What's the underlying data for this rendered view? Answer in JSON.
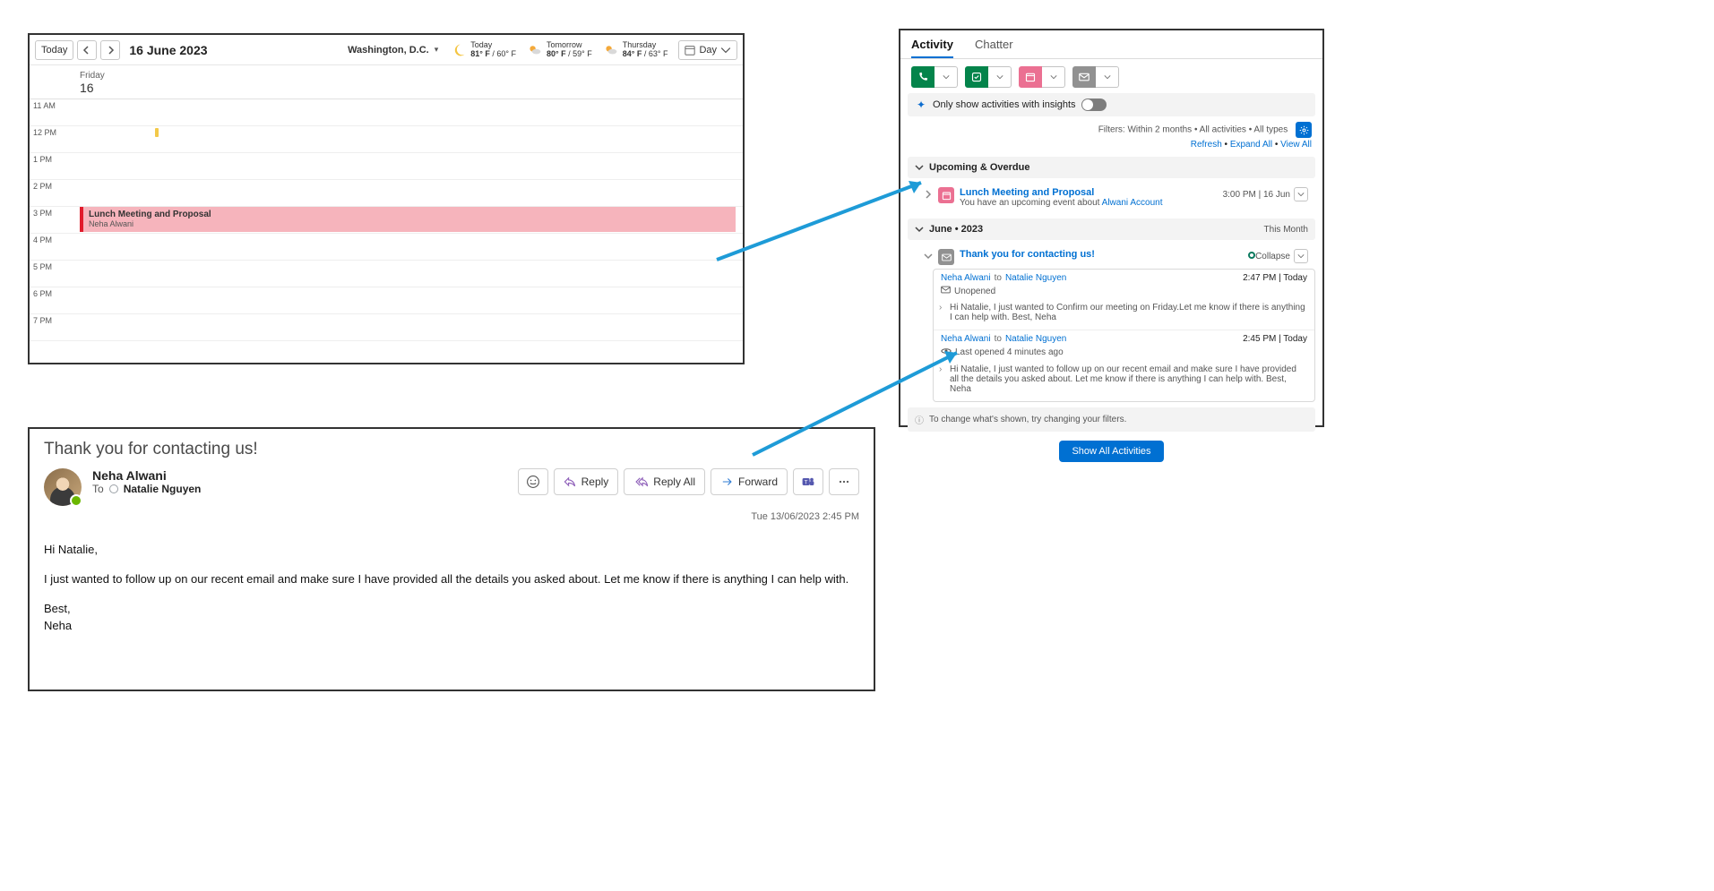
{
  "calendar": {
    "today_btn": "Today",
    "date_label": "16 June 2023",
    "location": "Washington, D.C.",
    "forecast": [
      {
        "label": "Today",
        "hi": "81° F",
        "lo": "60° F",
        "icon": "moon"
      },
      {
        "label": "Tomorrow",
        "hi": "80° F",
        "lo": "59° F",
        "icon": "sun-cloud"
      },
      {
        "label": "Thursday",
        "hi": "84° F",
        "lo": "63° F",
        "icon": "sun-cloud"
      }
    ],
    "view_label": "Day",
    "day_of_week": "Friday",
    "day_of_month": "16",
    "hours": [
      "11 AM",
      "12 PM",
      "1 PM",
      "2 PM",
      "3 PM",
      "4 PM",
      "5 PM",
      "6 PM",
      "7 PM"
    ],
    "busy_at_index": 1,
    "appointment": {
      "hour_index": 4,
      "title": "Lunch Meeting and Proposal",
      "who": "Neha Alwani"
    }
  },
  "activity": {
    "tabs": {
      "activity": "Activity",
      "chatter": "Chatter"
    },
    "insights_label": "Only show activities with insights",
    "filters_line": "Filters: Within 2 months • All activities • All types",
    "links": {
      "refresh": "Refresh",
      "expand": "Expand All",
      "view": "View All"
    },
    "section_upcoming": "Upcoming & Overdue",
    "upcoming_event": {
      "title": "Lunch Meeting and Proposal",
      "sub_prefix": "You have an upcoming event about ",
      "account": "Alwani Account",
      "when": "3:00 PM | 16 Jun"
    },
    "month_header": "June  •  2023",
    "month_rhs": "This Month",
    "email_thread": {
      "subject": "Thank you for contacting us!",
      "collapse": "Collapse",
      "msgs": [
        {
          "from": "Neha Alwani",
          "to": "Natalie Nguyen",
          "ts": "2:47 PM | Today",
          "status_icon": "envelope",
          "status": "Unopened",
          "snippet": "Hi Natalie, I just wanted to Confirm our meeting on Friday.Let me know if there is anything I can help with. Best, Neha"
        },
        {
          "from": "Neha Alwani",
          "to": "Natalie Nguyen",
          "ts": "2:45 PM | Today",
          "status_icon": "eye",
          "status": "Last opened 4 minutes ago",
          "snippet": "Hi Natalie, I just wanted to follow up on our recent email and make sure I have provided all the details you asked about. Let me know if there is anything I can help with. Best, Neha"
        }
      ]
    },
    "hint": "To change what's shown, try changing your filters.",
    "show_all_btn": "Show All Activities"
  },
  "email": {
    "subject": "Thank you for contacting us!",
    "from": "Neha Alwani",
    "to_label": "To",
    "recipient": "Natalie Nguyen",
    "timestamp": "Tue 13/06/2023 2:45 PM",
    "actions": {
      "reply": "Reply",
      "reply_all": "Reply All",
      "forward": "Forward"
    },
    "body": {
      "greeting": "Hi Natalie,",
      "para": "I just wanted to follow up on our recent email and make sure I have provided all the details you asked about. Let me know if there is anything I can help with.",
      "sig1": "Best,",
      "sig2": "Neha"
    }
  }
}
